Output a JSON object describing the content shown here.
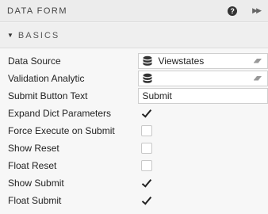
{
  "header": {
    "title": "DATA FORM"
  },
  "section": {
    "title": "BASICS"
  },
  "rows": {
    "data_source": {
      "label": "Data Source",
      "value": "Viewstates"
    },
    "validation_analytic": {
      "label": "Validation Analytic",
      "value": ""
    },
    "submit_button_text": {
      "label": "Submit Button Text",
      "value": "Submit"
    },
    "expand_dict_parameters": {
      "label": "Expand Dict Parameters",
      "checked": true
    },
    "force_execute_on_submit": {
      "label": "Force Execute on Submit",
      "checked": false
    },
    "show_reset": {
      "label": "Show Reset",
      "checked": false
    },
    "float_reset": {
      "label": "Float Reset",
      "checked": false
    },
    "show_submit": {
      "label": "Show Submit",
      "checked": true
    },
    "float_submit": {
      "label": "Float Submit",
      "checked": true
    }
  },
  "icons": {
    "help": "help-circle-icon",
    "expand": "double-chevron-right-icon",
    "section_toggle": "caret-down-icon",
    "database": "database-icon",
    "clear": "eraser-icon"
  }
}
